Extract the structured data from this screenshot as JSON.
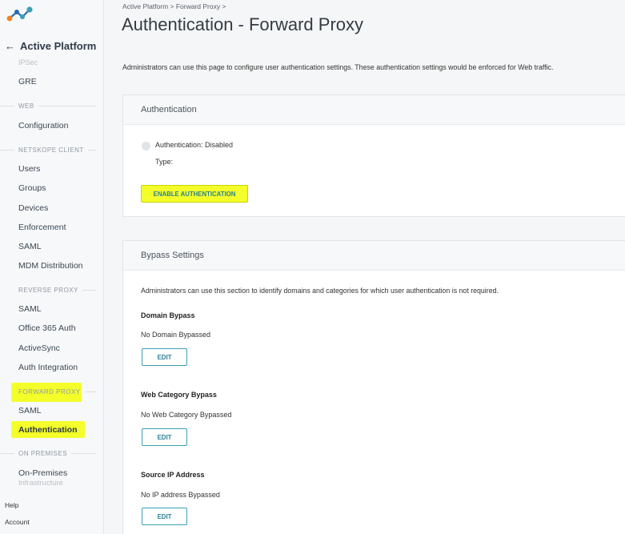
{
  "app": {
    "logo_icon": "netskope-logo-icon",
    "brand_colors": [
      "#f58220",
      "#2b6bb3",
      "#3aa0b4"
    ]
  },
  "sidebar": {
    "title": "Active Platform",
    "faded_item": "IPSec",
    "gre": "GRE",
    "sections": {
      "web": "WEB",
      "netskope_client": "NETSKOPE CLIENT",
      "reverse_proxy": "REVERSE PROXY",
      "forward_proxy": "FORWARD PROXY",
      "on_premises": "ON PREMISES"
    },
    "web_items": [
      "Configuration"
    ],
    "client_items": [
      "Users",
      "Groups",
      "Devices",
      "Enforcement",
      "SAML",
      "MDM Distribution"
    ],
    "reverse_items": [
      "SAML",
      "Office 365 Auth",
      "ActiveSync",
      "Auth Integration"
    ],
    "forward_items": [
      "SAML",
      "Authentication"
    ],
    "onprem_items": [
      "On-Premises",
      "Infrastructure"
    ],
    "bottom": [
      "Help",
      "Account"
    ],
    "highlight_color": "#f4ff2a"
  },
  "main": {
    "breadcrumb": "Active Platform > Forward Proxy >",
    "title": "Authentication - Forward Proxy",
    "description": "Administrators can use this page to configure user authentication settings. These authentication settings would be enforced for Web traffic.",
    "auth_card": {
      "header": "Authentication",
      "status": "Authentication: Disabled",
      "type_label": "Type:",
      "enable_button": "ENABLE AUTHENTICATION"
    },
    "bypass_card": {
      "header": "Bypass Settings",
      "description": "Administrators can use this section to identify domains and categories for which user authentication is not required.",
      "domain_title": "Domain Bypass",
      "domain_value": "No Domain Bypassed",
      "category_title": "Web Category Bypass",
      "category_value": "No Web Category Bypassed",
      "ip_title": "Source IP Address",
      "ip_value": "No IP address Bypassed",
      "edit_label": "EDIT"
    }
  }
}
